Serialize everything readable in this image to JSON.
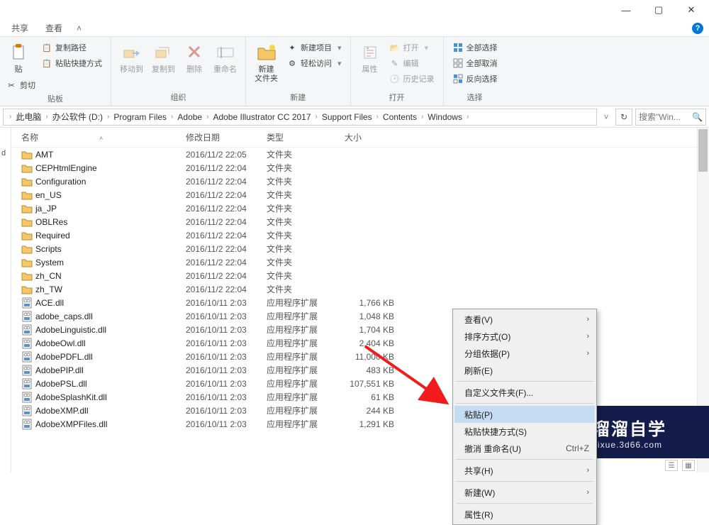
{
  "window": {
    "tabs": {
      "share": "共享",
      "view": "查看"
    }
  },
  "ribbon": {
    "clipboard": {
      "paste": "贴",
      "cut": "剪切",
      "copy_path": "复制路径",
      "paste_shortcut": "粘贴快捷方式",
      "group": "贴板"
    },
    "organize": {
      "move_to": "移动到",
      "copy_to": "复制到",
      "delete": "删除",
      "rename": "重命名",
      "group": "组织"
    },
    "new": {
      "new_folder": "新建\n文件夹",
      "new_item": "新建项目",
      "easy_access": "轻松访问",
      "group": "新建"
    },
    "open": {
      "properties": "属性",
      "open": "打开",
      "edit": "编辑",
      "history": "历史记录",
      "group": "打开"
    },
    "select": {
      "select_all": "全部选择",
      "select_none": "全部取消",
      "invert": "反向选择",
      "group": "选择"
    }
  },
  "breadcrumb": [
    "此电脑",
    "办公软件 (D:)",
    "Program Files",
    "Adobe",
    "Adobe Illustrator CC 2017",
    "Support Files",
    "Contents",
    "Windows"
  ],
  "search_placeholder": "搜索\"Win...",
  "columns": {
    "name": "名称",
    "date": "修改日期",
    "type": "类型",
    "size": "大小"
  },
  "tree_label": "d",
  "rows": [
    {
      "name": "AMT",
      "date": "2016/11/2 22:05",
      "type": "文件夹",
      "size": "",
      "folder": true
    },
    {
      "name": "CEPHtmlEngine",
      "date": "2016/11/2 22:04",
      "type": "文件夹",
      "size": "",
      "folder": true
    },
    {
      "name": "Configuration",
      "date": "2016/11/2 22:04",
      "type": "文件夹",
      "size": "",
      "folder": true
    },
    {
      "name": "en_US",
      "date": "2016/11/2 22:04",
      "type": "文件夹",
      "size": "",
      "folder": true
    },
    {
      "name": "ja_JP",
      "date": "2016/11/2 22:04",
      "type": "文件夹",
      "size": "",
      "folder": true
    },
    {
      "name": "OBLRes",
      "date": "2016/11/2 22:04",
      "type": "文件夹",
      "size": "",
      "folder": true
    },
    {
      "name": "Required",
      "date": "2016/11/2 22:04",
      "type": "文件夹",
      "size": "",
      "folder": true
    },
    {
      "name": "Scripts",
      "date": "2016/11/2 22:04",
      "type": "文件夹",
      "size": "",
      "folder": true
    },
    {
      "name": "System",
      "date": "2016/11/2 22:04",
      "type": "文件夹",
      "size": "",
      "folder": true
    },
    {
      "name": "zh_CN",
      "date": "2016/11/2 22:04",
      "type": "文件夹",
      "size": "",
      "folder": true
    },
    {
      "name": "zh_TW",
      "date": "2016/11/2 22:04",
      "type": "文件夹",
      "size": "",
      "folder": true
    },
    {
      "name": "ACE.dll",
      "date": "2016/10/11 2:03",
      "type": "应用程序扩展",
      "size": "1,766 KB",
      "folder": false
    },
    {
      "name": "adobe_caps.dll",
      "date": "2016/10/11 2:03",
      "type": "应用程序扩展",
      "size": "1,048 KB",
      "folder": false
    },
    {
      "name": "AdobeLinguistic.dll",
      "date": "2016/10/11 2:03",
      "type": "应用程序扩展",
      "size": "1,704 KB",
      "folder": false
    },
    {
      "name": "AdobeOwl.dll",
      "date": "2016/10/11 2:03",
      "type": "应用程序扩展",
      "size": "2,404 KB",
      "folder": false
    },
    {
      "name": "AdobePDFL.dll",
      "date": "2016/10/11 2:03",
      "type": "应用程序扩展",
      "size": "11,000 KB",
      "folder": false
    },
    {
      "name": "AdobePIP.dll",
      "date": "2016/10/11 2:03",
      "type": "应用程序扩展",
      "size": "483 KB",
      "folder": false
    },
    {
      "name": "AdobePSL.dll",
      "date": "2016/10/11 2:03",
      "type": "应用程序扩展",
      "size": "107,551 KB",
      "folder": false
    },
    {
      "name": "AdobeSplashKit.dll",
      "date": "2016/10/11 2:03",
      "type": "应用程序扩展",
      "size": "61 KB",
      "folder": false
    },
    {
      "name": "AdobeXMP.dll",
      "date": "2016/10/11 2:03",
      "type": "应用程序扩展",
      "size": "244 KB",
      "folder": false
    },
    {
      "name": "AdobeXMPFiles.dll",
      "date": "2016/10/11 2:03",
      "type": "应用程序扩展",
      "size": "1,291 KB",
      "folder": false
    }
  ],
  "context_menu": {
    "view": "查看(V)",
    "sort": "排序方式(O)",
    "group": "分组依据(P)",
    "refresh": "刷新(E)",
    "customize": "自定义文件夹(F)...",
    "paste": "粘贴(P)",
    "paste_shortcut": "粘贴快捷方式(S)",
    "undo_rename": "撤消 重命名(U)",
    "undo_shortcut": "Ctrl+Z",
    "share": "共享(H)",
    "new": "新建(W)",
    "properties": "属性(R)"
  },
  "watermark": {
    "title": "溜溜自学",
    "url": "zixue.3d66.com"
  }
}
